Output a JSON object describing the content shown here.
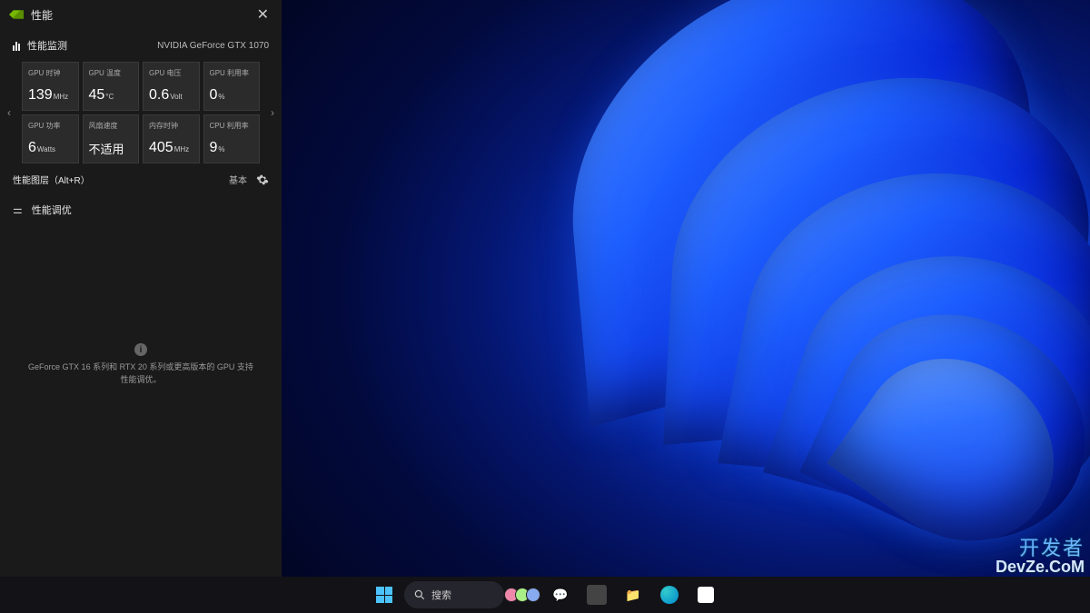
{
  "panel": {
    "title": "性能",
    "section_label": "性能监测",
    "gpu_name": "NVIDIA GeForce GTX 1070",
    "metrics": [
      {
        "label": "GPU 时钟",
        "value": "139",
        "unit": "MHz"
      },
      {
        "label": "GPU 温度",
        "value": "45",
        "unit": "°C"
      },
      {
        "label": "GPU 电压",
        "value": "0.6",
        "unit": "Volt"
      },
      {
        "label": "GPU 利用率",
        "value": "0",
        "unit": "%"
      },
      {
        "label": "GPU 功率",
        "value": "6",
        "unit": "Watts"
      },
      {
        "label": "风扇速度",
        "value": "不适用",
        "unit": ""
      },
      {
        "label": "内存时钟",
        "value": "405",
        "unit": "MHz"
      },
      {
        "label": "CPU 利用率",
        "value": "9",
        "unit": "%"
      }
    ],
    "overlay_label": "性能图层（Alt+R）",
    "overlay_mode": "基本",
    "tuning_label": "性能调优",
    "info_text": "GeForce GTX 16 系列和 RTX 20 系列或更高版本的 GPU 支持性能调优。"
  },
  "taskbar": {
    "search_placeholder": "搜索"
  },
  "watermark": {
    "cn": "开发者",
    "en": "DevZe.CoM"
  }
}
